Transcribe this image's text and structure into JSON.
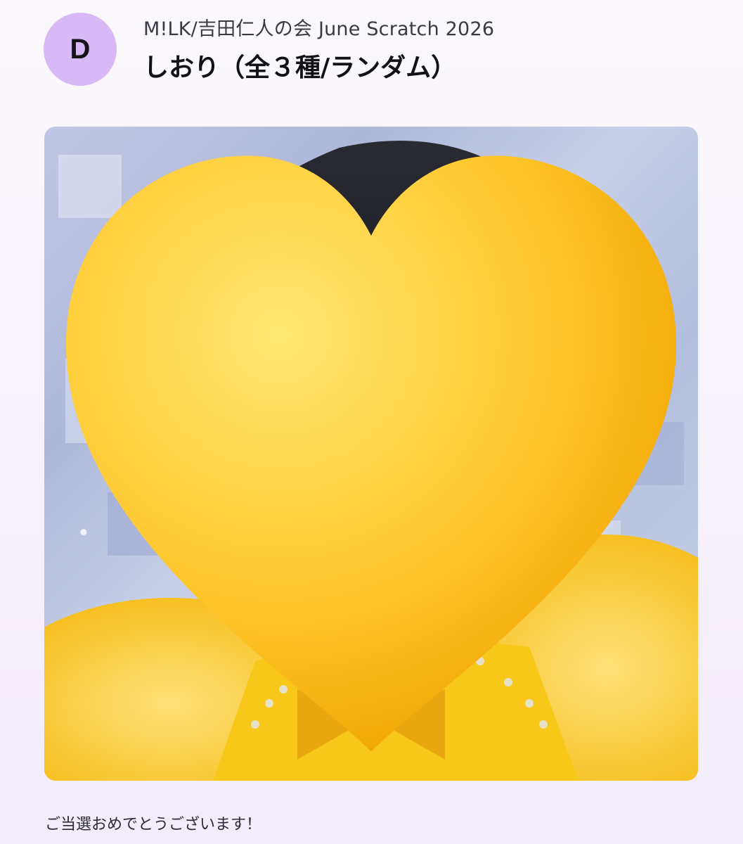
{
  "header": {
    "grade": "D",
    "subtitle": "M!LK/吉田仁人の会 June Scratch 2026",
    "title": "しおり（全３種/ランダム）"
  },
  "prize_image": {
    "alt": "Bookmark photo",
    "sticker_icon": "yellow-heart-icon"
  },
  "message": "ご当選おめでとうございます！",
  "colors": {
    "badge": "#d9b8f6",
    "heart": "#ffc72c",
    "outfit": "#f7c81a"
  }
}
